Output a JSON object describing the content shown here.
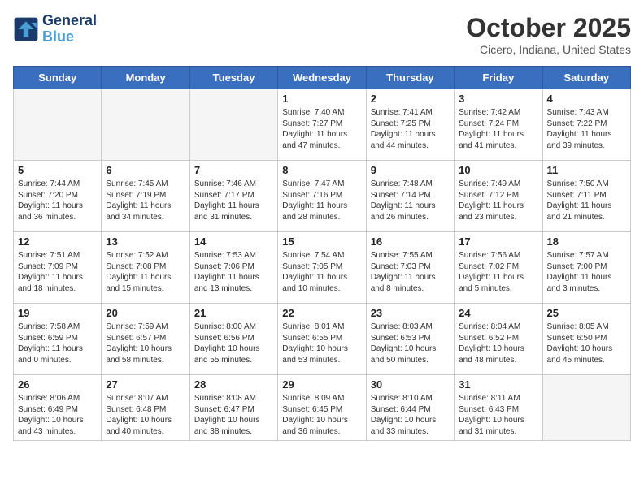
{
  "logo": {
    "line1": "General",
    "line2": "Blue"
  },
  "title": "October 2025",
  "subtitle": "Cicero, Indiana, United States",
  "weekdays": [
    "Sunday",
    "Monday",
    "Tuesday",
    "Wednesday",
    "Thursday",
    "Friday",
    "Saturday"
  ],
  "weeks": [
    [
      {
        "day": "",
        "sunrise": "",
        "sunset": "",
        "daylight": ""
      },
      {
        "day": "",
        "sunrise": "",
        "sunset": "",
        "daylight": ""
      },
      {
        "day": "",
        "sunrise": "",
        "sunset": "",
        "daylight": ""
      },
      {
        "day": "1",
        "sunrise": "Sunrise: 7:40 AM",
        "sunset": "Sunset: 7:27 PM",
        "daylight": "Daylight: 11 hours and 47 minutes."
      },
      {
        "day": "2",
        "sunrise": "Sunrise: 7:41 AM",
        "sunset": "Sunset: 7:25 PM",
        "daylight": "Daylight: 11 hours and 44 minutes."
      },
      {
        "day": "3",
        "sunrise": "Sunrise: 7:42 AM",
        "sunset": "Sunset: 7:24 PM",
        "daylight": "Daylight: 11 hours and 41 minutes."
      },
      {
        "day": "4",
        "sunrise": "Sunrise: 7:43 AM",
        "sunset": "Sunset: 7:22 PM",
        "daylight": "Daylight: 11 hours and 39 minutes."
      }
    ],
    [
      {
        "day": "5",
        "sunrise": "Sunrise: 7:44 AM",
        "sunset": "Sunset: 7:20 PM",
        "daylight": "Daylight: 11 hours and 36 minutes."
      },
      {
        "day": "6",
        "sunrise": "Sunrise: 7:45 AM",
        "sunset": "Sunset: 7:19 PM",
        "daylight": "Daylight: 11 hours and 34 minutes."
      },
      {
        "day": "7",
        "sunrise": "Sunrise: 7:46 AM",
        "sunset": "Sunset: 7:17 PM",
        "daylight": "Daylight: 11 hours and 31 minutes."
      },
      {
        "day": "8",
        "sunrise": "Sunrise: 7:47 AM",
        "sunset": "Sunset: 7:16 PM",
        "daylight": "Daylight: 11 hours and 28 minutes."
      },
      {
        "day": "9",
        "sunrise": "Sunrise: 7:48 AM",
        "sunset": "Sunset: 7:14 PM",
        "daylight": "Daylight: 11 hours and 26 minutes."
      },
      {
        "day": "10",
        "sunrise": "Sunrise: 7:49 AM",
        "sunset": "Sunset: 7:12 PM",
        "daylight": "Daylight: 11 hours and 23 minutes."
      },
      {
        "day": "11",
        "sunrise": "Sunrise: 7:50 AM",
        "sunset": "Sunset: 7:11 PM",
        "daylight": "Daylight: 11 hours and 21 minutes."
      }
    ],
    [
      {
        "day": "12",
        "sunrise": "Sunrise: 7:51 AM",
        "sunset": "Sunset: 7:09 PM",
        "daylight": "Daylight: 11 hours and 18 minutes."
      },
      {
        "day": "13",
        "sunrise": "Sunrise: 7:52 AM",
        "sunset": "Sunset: 7:08 PM",
        "daylight": "Daylight: 11 hours and 15 minutes."
      },
      {
        "day": "14",
        "sunrise": "Sunrise: 7:53 AM",
        "sunset": "Sunset: 7:06 PM",
        "daylight": "Daylight: 11 hours and 13 minutes."
      },
      {
        "day": "15",
        "sunrise": "Sunrise: 7:54 AM",
        "sunset": "Sunset: 7:05 PM",
        "daylight": "Daylight: 11 hours and 10 minutes."
      },
      {
        "day": "16",
        "sunrise": "Sunrise: 7:55 AM",
        "sunset": "Sunset: 7:03 PM",
        "daylight": "Daylight: 11 hours and 8 minutes."
      },
      {
        "day": "17",
        "sunrise": "Sunrise: 7:56 AM",
        "sunset": "Sunset: 7:02 PM",
        "daylight": "Daylight: 11 hours and 5 minutes."
      },
      {
        "day": "18",
        "sunrise": "Sunrise: 7:57 AM",
        "sunset": "Sunset: 7:00 PM",
        "daylight": "Daylight: 11 hours and 3 minutes."
      }
    ],
    [
      {
        "day": "19",
        "sunrise": "Sunrise: 7:58 AM",
        "sunset": "Sunset: 6:59 PM",
        "daylight": "Daylight: 11 hours and 0 minutes."
      },
      {
        "day": "20",
        "sunrise": "Sunrise: 7:59 AM",
        "sunset": "Sunset: 6:57 PM",
        "daylight": "Daylight: 10 hours and 58 minutes."
      },
      {
        "day": "21",
        "sunrise": "Sunrise: 8:00 AM",
        "sunset": "Sunset: 6:56 PM",
        "daylight": "Daylight: 10 hours and 55 minutes."
      },
      {
        "day": "22",
        "sunrise": "Sunrise: 8:01 AM",
        "sunset": "Sunset: 6:55 PM",
        "daylight": "Daylight: 10 hours and 53 minutes."
      },
      {
        "day": "23",
        "sunrise": "Sunrise: 8:03 AM",
        "sunset": "Sunset: 6:53 PM",
        "daylight": "Daylight: 10 hours and 50 minutes."
      },
      {
        "day": "24",
        "sunrise": "Sunrise: 8:04 AM",
        "sunset": "Sunset: 6:52 PM",
        "daylight": "Daylight: 10 hours and 48 minutes."
      },
      {
        "day": "25",
        "sunrise": "Sunrise: 8:05 AM",
        "sunset": "Sunset: 6:50 PM",
        "daylight": "Daylight: 10 hours and 45 minutes."
      }
    ],
    [
      {
        "day": "26",
        "sunrise": "Sunrise: 8:06 AM",
        "sunset": "Sunset: 6:49 PM",
        "daylight": "Daylight: 10 hours and 43 minutes."
      },
      {
        "day": "27",
        "sunrise": "Sunrise: 8:07 AM",
        "sunset": "Sunset: 6:48 PM",
        "daylight": "Daylight: 10 hours and 40 minutes."
      },
      {
        "day": "28",
        "sunrise": "Sunrise: 8:08 AM",
        "sunset": "Sunset: 6:47 PM",
        "daylight": "Daylight: 10 hours and 38 minutes."
      },
      {
        "day": "29",
        "sunrise": "Sunrise: 8:09 AM",
        "sunset": "Sunset: 6:45 PM",
        "daylight": "Daylight: 10 hours and 36 minutes."
      },
      {
        "day": "30",
        "sunrise": "Sunrise: 8:10 AM",
        "sunset": "Sunset: 6:44 PM",
        "daylight": "Daylight: 10 hours and 33 minutes."
      },
      {
        "day": "31",
        "sunrise": "Sunrise: 8:11 AM",
        "sunset": "Sunset: 6:43 PM",
        "daylight": "Daylight: 10 hours and 31 minutes."
      },
      {
        "day": "",
        "sunrise": "",
        "sunset": "",
        "daylight": ""
      }
    ]
  ]
}
